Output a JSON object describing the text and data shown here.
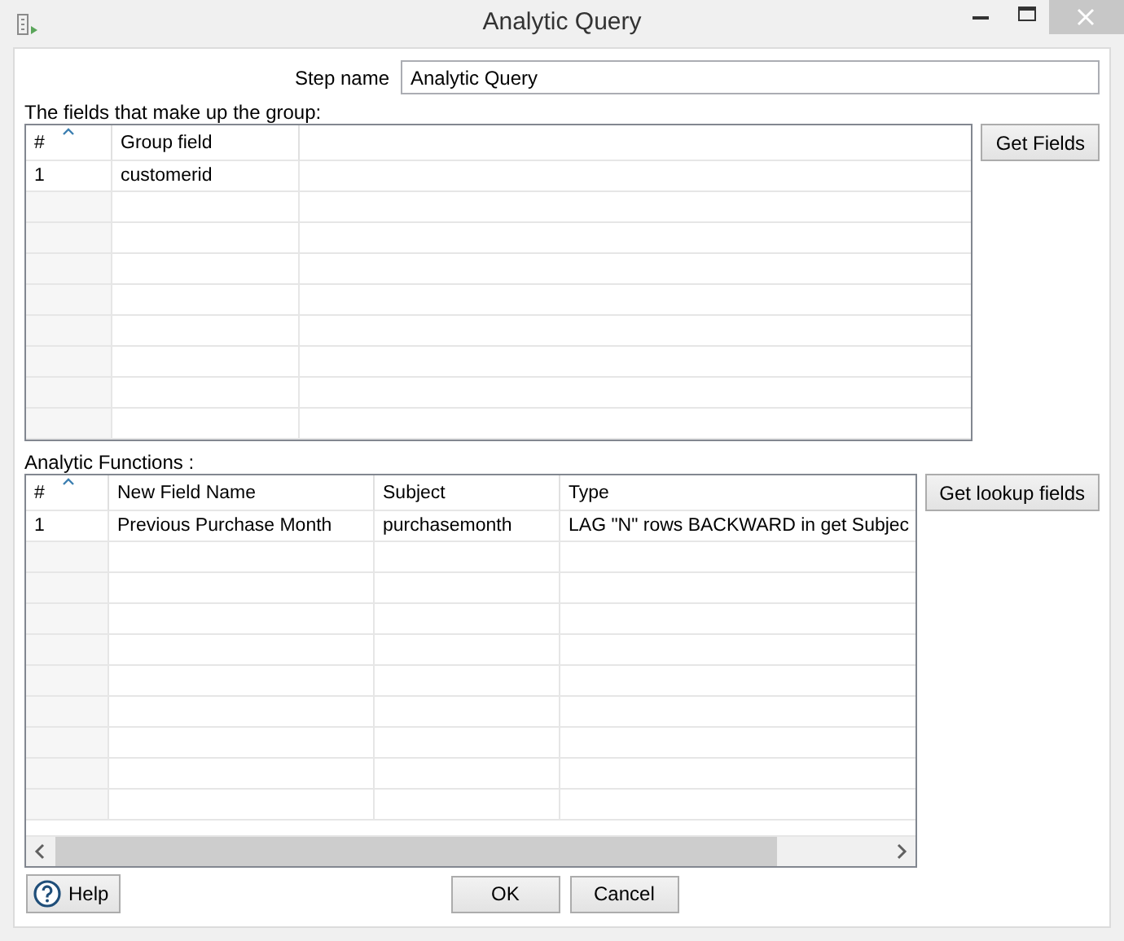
{
  "window": {
    "title": "Analytic Query"
  },
  "step_name": {
    "label": "Step name",
    "value": "Analytic Query"
  },
  "group_section": {
    "label": "The fields that make up the group:",
    "button": "Get Fields",
    "table": {
      "columns": [
        "#",
        "Group field"
      ],
      "rows": [
        [
          "1",
          "customerid"
        ]
      ]
    }
  },
  "functions_section": {
    "label": "Analytic Functions :",
    "button": "Get lookup fields",
    "table": {
      "columns": [
        "#",
        "New Field Name",
        "Subject",
        "Type"
      ],
      "rows": [
        [
          "1",
          "Previous Purchase Month",
          "purchasemonth",
          "LAG \"N\" rows BACKWARD in get Subjec"
        ]
      ]
    }
  },
  "footer_buttons": [
    {
      "kind": "help",
      "label": "Help"
    },
    {
      "kind": "ok",
      "label": "OK"
    },
    {
      "kind": "cancel",
      "label": "Cancel"
    }
  ]
}
